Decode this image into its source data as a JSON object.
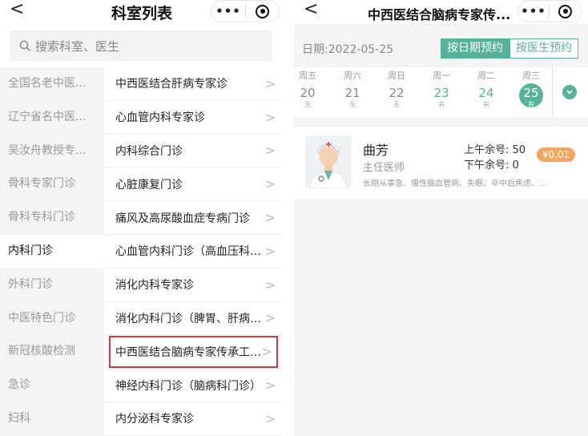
{
  "left": {
    "nav": {
      "back_glyph": "<",
      "title": "科室列表",
      "more_glyph": "•••"
    },
    "search": {
      "placeholder": "搜索科室、医生"
    },
    "categories": [
      {
        "label": "全国名老中医...",
        "active": false
      },
      {
        "label": "辽宁省名中医...",
        "active": false
      },
      {
        "label": "吴汝舟教授专...",
        "active": false
      },
      {
        "label": "骨科专家门诊",
        "active": false
      },
      {
        "label": "骨科专科门诊",
        "active": false
      },
      {
        "label": "内科门诊",
        "active": true
      },
      {
        "label": "外科门诊",
        "active": false
      },
      {
        "label": "中医特色门诊",
        "active": false
      },
      {
        "label": "新冠核酸检测",
        "active": false
      },
      {
        "label": "急诊",
        "active": false
      },
      {
        "label": "妇科",
        "active": false
      }
    ],
    "departments": [
      {
        "label": "中西医结合肝病专家诊"
      },
      {
        "label": "心血管内科专家诊"
      },
      {
        "label": "内科综合门诊"
      },
      {
        "label": "心脏康复门诊"
      },
      {
        "label": "痛风及高尿酸血症专病门诊"
      },
      {
        "label": "心血管内科门诊（高血压科…"
      },
      {
        "label": "消化内科专家诊"
      },
      {
        "label": "消化内科门诊（脾胃、肝病…"
      },
      {
        "label": "中西医结合脑病专家传承工…",
        "highlighted": true
      },
      {
        "label": "神经内科门诊（脑病科门诊）"
      },
      {
        "label": "内分泌科专家诊"
      }
    ],
    "chevron_glyph": ">",
    "highlight_color": "#d23a3a"
  },
  "right": {
    "nav": {
      "back_glyph": "<",
      "title": "中西医结合脑病专家传...",
      "more_glyph": "•••"
    },
    "date_label": "日期:2022-05-25",
    "mode_by_date": "按日期预约",
    "mode_by_doctor": "按医生预约",
    "accent_color": "#55b39a",
    "days": [
      {
        "weekday": "周五",
        "date": "20",
        "status": "无"
      },
      {
        "weekday": "周六",
        "date": "21",
        "status": "无"
      },
      {
        "weekday": "周日",
        "date": "22",
        "status": "无"
      },
      {
        "weekday": "周一",
        "date": "23",
        "status": "有"
      },
      {
        "weekday": "周二",
        "date": "24",
        "status": "有"
      },
      {
        "weekday": "周三",
        "date": "25",
        "status": "有",
        "selected": true
      }
    ],
    "expand_icon": "chevron-down-icon",
    "doctor": {
      "name": "曲芳",
      "title": "主任医师",
      "am_slots": "上午余号: 50",
      "pm_slots": "下午余号: 0",
      "price": "¥0.01",
      "description": "长期从事急、慢性脑血管病、失眠、卒中后焦虑、..."
    }
  }
}
